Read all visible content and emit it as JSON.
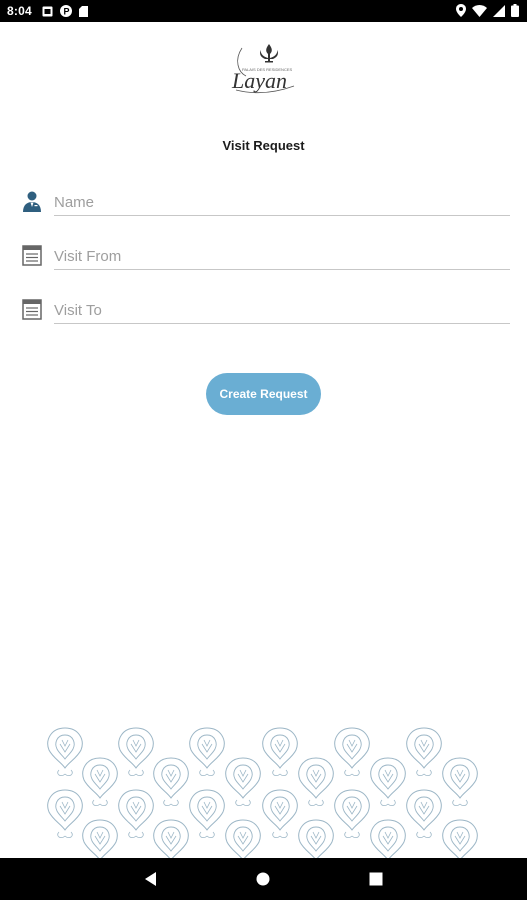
{
  "status_bar": {
    "time": "8:04",
    "left_icons": [
      "notification-square-icon",
      "notification-p-icon",
      "sd-card-icon"
    ],
    "right_icons": [
      "location-icon",
      "wifi-icon",
      "signal-icon",
      "battery-icon"
    ]
  },
  "logo": {
    "script_text": "Layan",
    "small_text": "PALAIS DES RESIDENCES"
  },
  "page": {
    "title": "Visit Request"
  },
  "form": {
    "fields": [
      {
        "label": "Name",
        "icon": "person-icon"
      },
      {
        "label": "Visit From",
        "icon": "calendar-icon"
      },
      {
        "label": "Visit To",
        "icon": "calendar-icon"
      }
    ],
    "submit_label": "Create Request"
  },
  "colors": {
    "accent": "#6aaed3",
    "icon": "#2f5f7f",
    "pattern": "#9cb6c6"
  },
  "nav_bar": {
    "buttons": [
      "back-icon",
      "home-icon",
      "recents-icon"
    ]
  }
}
